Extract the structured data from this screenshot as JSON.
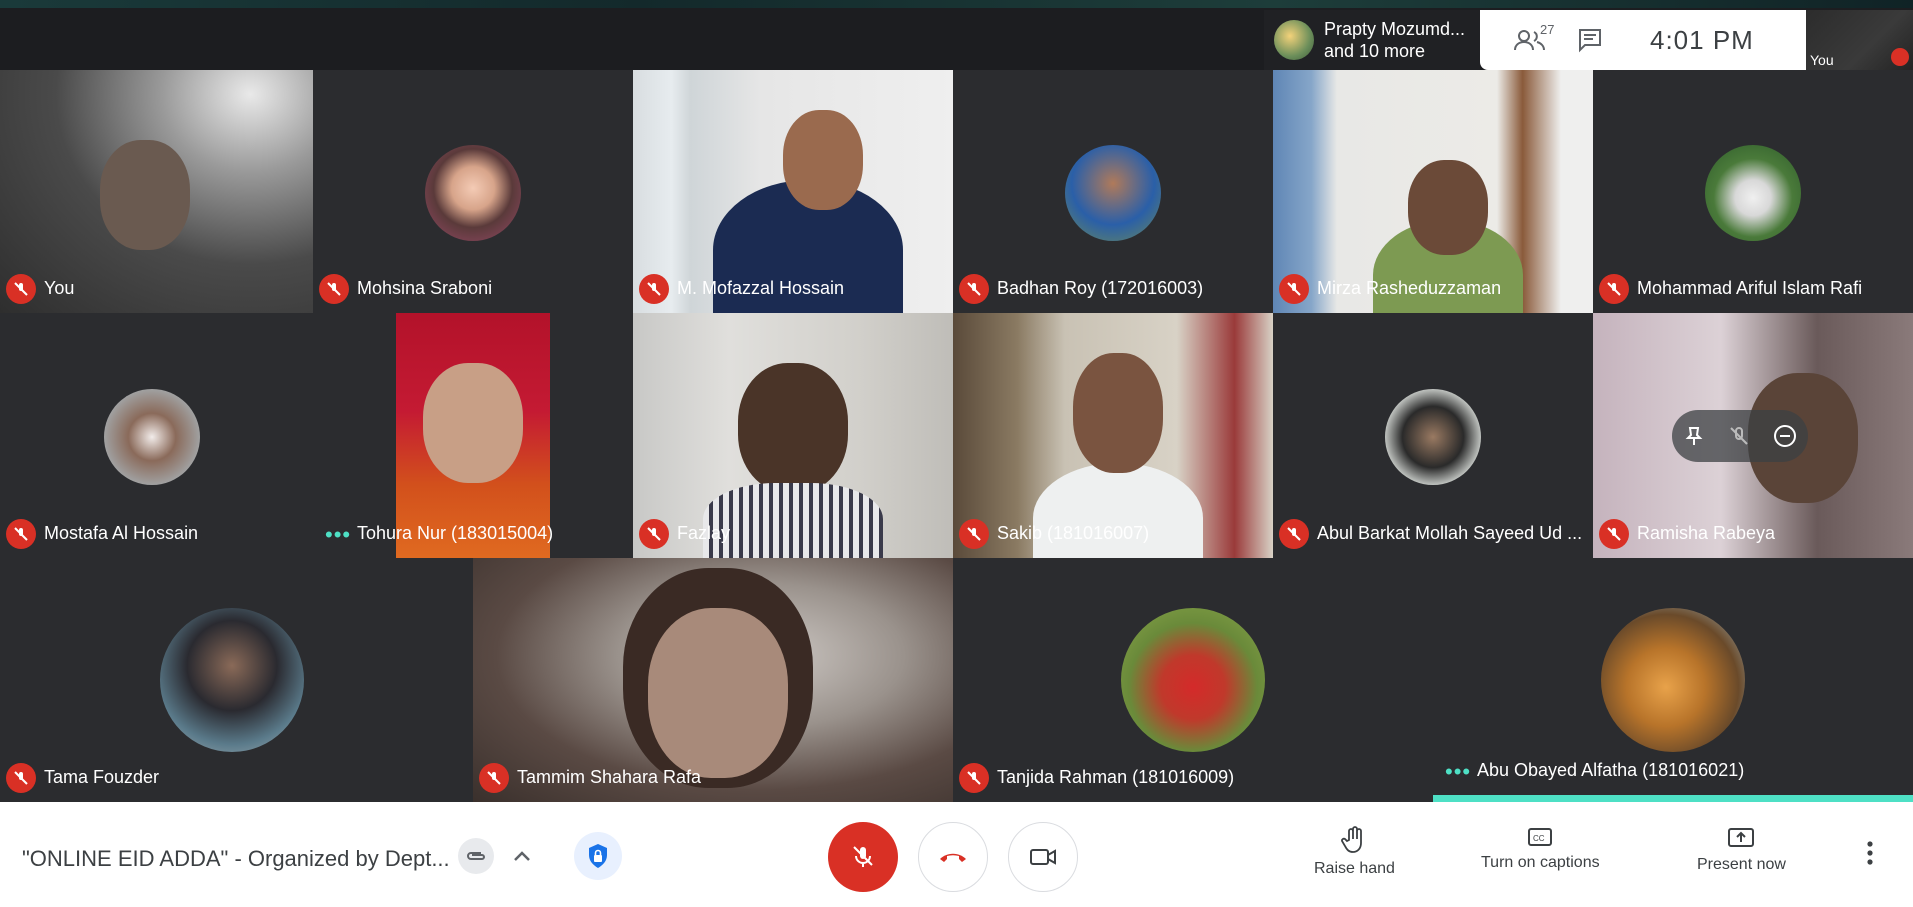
{
  "topbar": {
    "presenting": {
      "line1": "Prapty Mozumd...",
      "line2": "and 10 more"
    },
    "participants_count": "27",
    "time": "4:01  PM",
    "self_label": "You",
    "icons": [
      "people-icon",
      "chat-icon"
    ]
  },
  "tiles": [
    {
      "name": "You",
      "indicator": "muted"
    },
    {
      "name": "Mohsina Sraboni",
      "indicator": "muted"
    },
    {
      "name": "M. Mofazzal Hossain",
      "indicator": "muted"
    },
    {
      "name": "Badhan Roy (172016003)",
      "indicator": "muted"
    },
    {
      "name": "Mirza Rasheduzzaman",
      "indicator": "muted"
    },
    {
      "name": "Mohammad Ariful Islam Rafi",
      "indicator": "muted"
    },
    {
      "name": "Mostafa Al Hossain",
      "indicator": "muted"
    },
    {
      "name": "Tohura Nur (183015004)",
      "indicator": "speaking"
    },
    {
      "name": "Fazlay",
      "indicator": "muted"
    },
    {
      "name": "Sakib (181016007)",
      "indicator": "muted"
    },
    {
      "name": "Abul Barkat Mollah Sayeed Ud ...",
      "indicator": "muted"
    },
    {
      "name": "Ramisha Rabeya",
      "indicator": "muted"
    },
    {
      "name": "Tama Fouzder",
      "indicator": "muted"
    },
    {
      "name": "Tammim Shahara Rafa",
      "indicator": "muted"
    },
    {
      "name": "Tanjida Rahman (181016009)",
      "indicator": "muted"
    },
    {
      "name": "Abu Obayed Alfatha (181016021)",
      "indicator": "speaking"
    }
  ],
  "bottombar": {
    "meeting_title": "\"ONLINE EID ADDA\" - Organized by Dept...",
    "raise_hand": "Raise hand",
    "captions": "Turn on captions",
    "present": "Present now"
  },
  "colors": {
    "muted_red": "#d93025",
    "speaking_teal": "#4ee0c5",
    "background": "#202124"
  }
}
